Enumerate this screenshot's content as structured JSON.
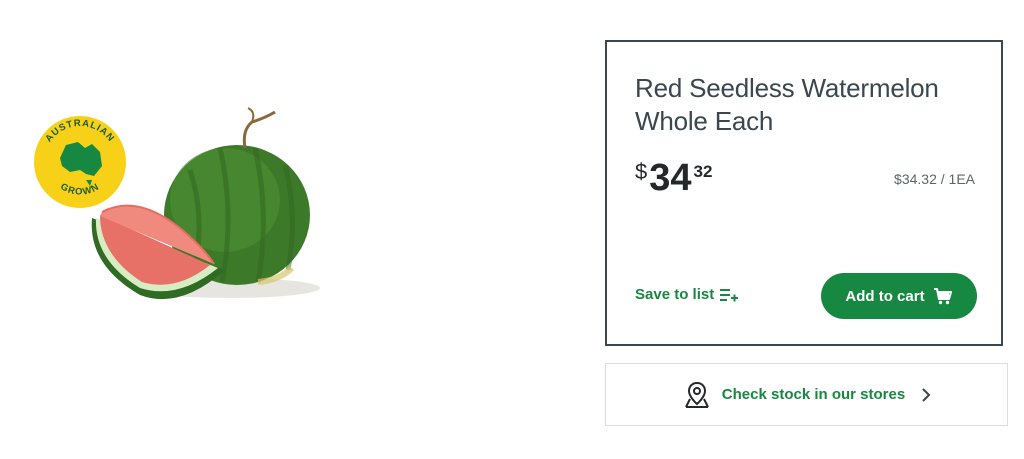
{
  "product": {
    "title": "Red Seedless Watermelon Whole Each",
    "badge": {
      "top_text": "AUSTRALIAN",
      "bottom_text": "GROWN",
      "color": "#f7d117",
      "map_color": "#178841"
    },
    "price": {
      "currency": "$",
      "dollars": "34",
      "cents": "32",
      "unit_price": "$34.32 / 1EA"
    }
  },
  "actions": {
    "save_label": "Save to list",
    "save_icon": "list-add-icon",
    "add_label": "Add to cart",
    "add_icon": "cart-icon"
  },
  "stock": {
    "label": "Check stock in our stores",
    "icon": "map-pin-icon",
    "chevron_icon": "chevron-right-icon"
  },
  "colors": {
    "brand_green": "#178841",
    "text_dark": "#3a474e",
    "border": "#3a474e"
  }
}
